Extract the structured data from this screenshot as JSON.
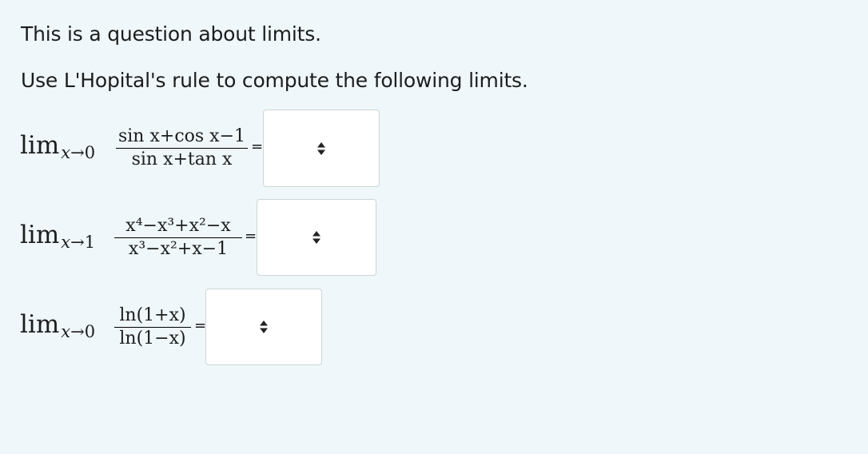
{
  "question": {
    "intro": "This is a question about limits.",
    "instruction": "Use L'Hopital's rule to compute the following limits."
  },
  "limits": [
    {
      "lim": "lim",
      "sub_var": "x",
      "sub_arrow": "→",
      "sub_target": "0",
      "numerator": "sin x+cos x−1",
      "denominator": "sin x+tan x",
      "equals": "=",
      "answer": ""
    },
    {
      "lim": "lim",
      "sub_var": "x",
      "sub_arrow": "→",
      "sub_target": "1",
      "numerator": "x⁴−x³+x²−x",
      "denominator": "x³−x²+x−1",
      "equals": "=",
      "answer": ""
    },
    {
      "lim": "lim",
      "sub_var": "x",
      "sub_arrow": "→",
      "sub_target": "0",
      "numerator": "ln(1+x)",
      "denominator": "ln(1−x)",
      "equals": "=",
      "answer": ""
    }
  ],
  "icons": {
    "select": "up-down-arrow-icon"
  }
}
